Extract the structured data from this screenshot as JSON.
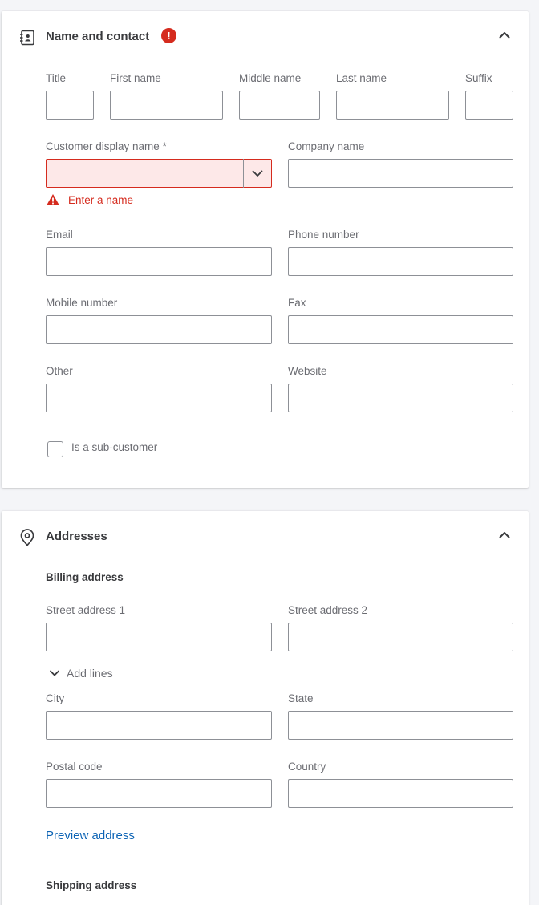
{
  "name_contact": {
    "title": "Name and contact",
    "error_badge": "!",
    "labels": {
      "title": "Title",
      "first_name": "First name",
      "middle_name": "Middle name",
      "last_name": "Last name",
      "suffix": "Suffix",
      "display_name": "Customer display name *",
      "company_name": "Company name",
      "email": "Email",
      "phone": "Phone number",
      "mobile": "Mobile number",
      "fax": "Fax",
      "other": "Other",
      "website": "Website"
    },
    "values": {
      "title": "",
      "first_name": "",
      "middle_name": "",
      "last_name": "",
      "suffix": "",
      "display_name": "",
      "company_name": "",
      "email": "",
      "phone": "",
      "mobile": "",
      "fax": "",
      "other": "",
      "website": ""
    },
    "display_name_error": "Enter a name",
    "sub_customer_label": "Is a sub-customer",
    "sub_customer_checked": false
  },
  "addresses": {
    "title": "Addresses",
    "billing_title": "Billing address",
    "labels": {
      "street1": "Street address 1",
      "street2": "Street address 2",
      "city": "City",
      "state": "State",
      "postal": "Postal code",
      "country": "Country"
    },
    "values": {
      "street1": "",
      "street2": "",
      "city": "",
      "state": "",
      "postal": "",
      "country": ""
    },
    "add_lines": "Add lines",
    "preview_link": "Preview address",
    "shipping_title": "Shipping address"
  },
  "colors": {
    "error": "#d52b1e",
    "link": "#0d64b5",
    "border": "#8d9096",
    "label": "#6b6c72"
  },
  "icons": {
    "name_section": "contact-book-icon",
    "address_section": "location-pin-icon",
    "collapse": "chevron-up-icon",
    "combo": "chevron-down-icon",
    "error": "warning-triangle-icon"
  }
}
